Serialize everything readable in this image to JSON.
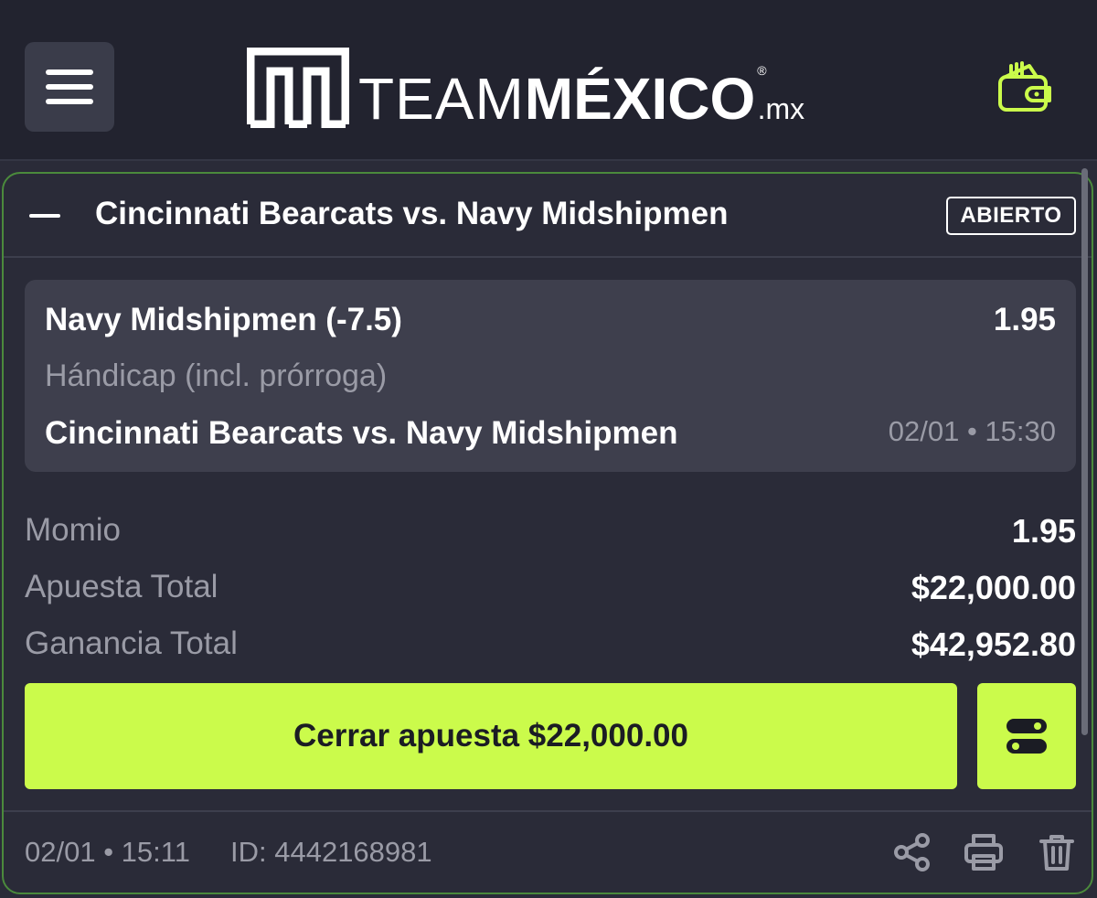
{
  "header": {
    "logo": {
      "team": "TEAM",
      "mexico": "MÉXICO",
      "reg": "®",
      "tld": ".mx"
    },
    "icons": {
      "menu": "hamburger-menu-icon",
      "wallet": "wallet-icon"
    },
    "accent_color": "#cbfb4b"
  },
  "bet": {
    "title": "Cincinnati Bearcats vs. Navy Midshipmen",
    "status": "ABIERTO",
    "selection": {
      "team": "Navy Midshipmen (-7.5)",
      "odds": "1.95",
      "market": "Hándicap (incl. prórroga)",
      "event": "Cincinnati Bearcats vs. Navy Midshipmen",
      "datetime": "02/01 • 15:30"
    },
    "summary": [
      {
        "label": "Momio",
        "value": "1.95"
      },
      {
        "label": "Apuesta Total",
        "value": "$22,000.00"
      },
      {
        "label": "Ganancia Total",
        "value": "$42,952.80"
      }
    ],
    "cashout_label": "Cerrar apuesta $22,000.00",
    "footer": {
      "datetime": "02/01 • 15:11",
      "id": "ID: 4442168981",
      "icons": [
        "share-icon",
        "print-icon",
        "trash-icon"
      ]
    },
    "border_color": "#4b8a3c"
  }
}
